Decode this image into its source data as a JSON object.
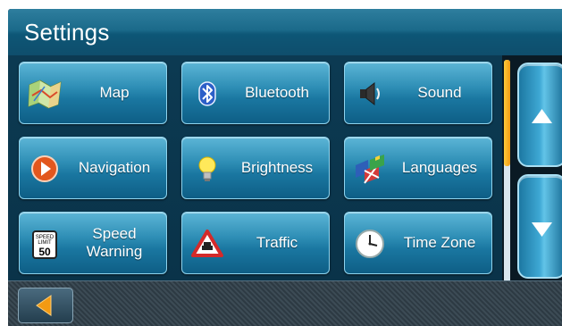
{
  "header": {
    "title": "Settings"
  },
  "tiles": [
    {
      "label": "Map",
      "icon": "map-icon"
    },
    {
      "label": "Bluetooth",
      "icon": "bluetooth-icon"
    },
    {
      "label": "Sound",
      "icon": "speaker-icon"
    },
    {
      "label": "Navigation",
      "icon": "navigation-arrow-icon"
    },
    {
      "label": "Brightness",
      "icon": "lightbulb-icon"
    },
    {
      "label": "Languages",
      "icon": "flags-icon"
    },
    {
      "label": "Speed\nWarning",
      "icon": "speed-limit-sign-icon",
      "sign_text": [
        "SPEED",
        "LIMIT",
        "50"
      ]
    },
    {
      "label": "Traffic",
      "icon": "traffic-warning-icon"
    },
    {
      "label": "Time Zone",
      "icon": "clock-icon"
    }
  ],
  "scrollbar": {
    "position": "top",
    "visible_fraction": 0.48
  },
  "controls": {
    "scroll_up": "up-arrow-icon",
    "scroll_down": "down-arrow-icon",
    "back": "back-arrow-icon"
  },
  "colors": {
    "accent": "#f39a12",
    "tile": "#2f8fb6",
    "header": "#1b6a8a"
  }
}
